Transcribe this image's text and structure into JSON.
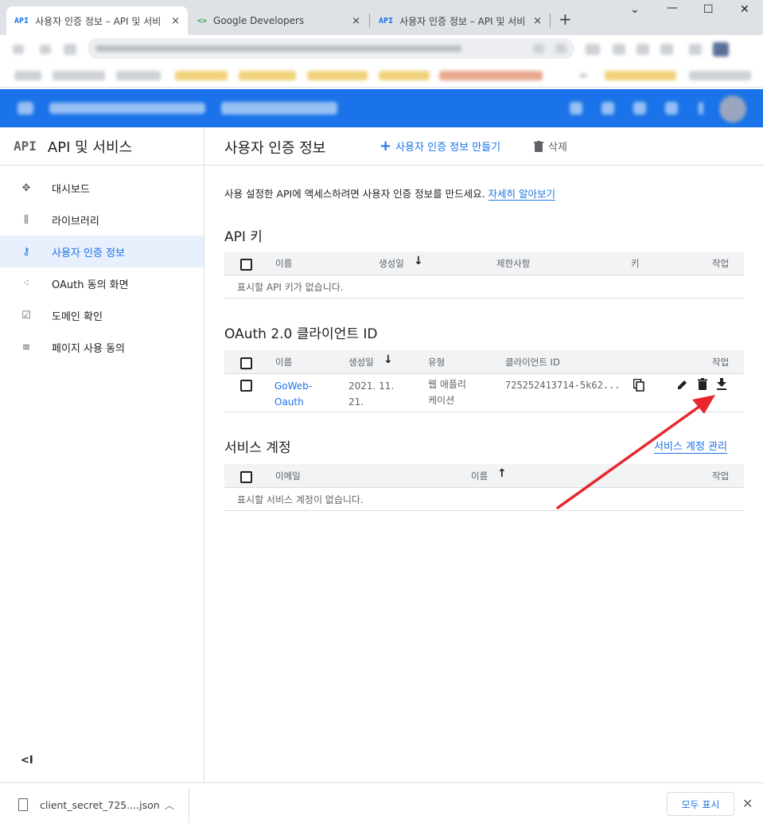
{
  "browser": {
    "tabs": [
      {
        "favicon": "API",
        "title": "사용자 인증 정보 – API 및 서비",
        "close": "×"
      },
      {
        "favicon": "<>",
        "title": "Google Developers",
        "close": "×"
      },
      {
        "favicon": "API",
        "title": "사용자 인증 정보 – API 및 서비",
        "close": "×"
      }
    ],
    "new_tab": "+",
    "window_controls": {
      "minimize": "⌄",
      "restore": "—",
      "maximize": "☐",
      "close": "✕"
    }
  },
  "sidebar": {
    "logo": "API",
    "title": "API 및 서비스",
    "items": [
      {
        "label": "대시보드",
        "icon": "dashboard-icon",
        "glyph": "✥"
      },
      {
        "label": "라이브러리",
        "icon": "library-icon",
        "glyph": "⫼"
      },
      {
        "label": "사용자 인증 정보",
        "icon": "key-icon",
        "glyph": "⚷"
      },
      {
        "label": "OAuth 동의 화면",
        "icon": "consent-icon",
        "glyph": "⁖"
      },
      {
        "label": "도메인 확인",
        "icon": "checkbox-icon",
        "glyph": "☑"
      },
      {
        "label": "페이지 사용 동의",
        "icon": "settings-list-icon",
        "glyph": "≡"
      }
    ],
    "active_index": 2,
    "collapse": "<I"
  },
  "main": {
    "title": "사용자 인증 정보",
    "create_label": "사용자 인증 정보 만들기",
    "delete_label": "삭제",
    "intro_text": "사용 설정한 API에 액세스하려면 사용자 인증 정보를 만드세요. ",
    "intro_link": "자세히 알아보기"
  },
  "api_keys": {
    "title": "API 키",
    "columns": {
      "name": "이름",
      "created": "생성일",
      "restrictions": "제한사항",
      "key": "키",
      "actions": "작업"
    },
    "empty": "표시할 API 키가 없습니다."
  },
  "oauth": {
    "title": "OAuth 2.0 클라이언트 ID",
    "columns": {
      "name": "이름",
      "created": "생성일",
      "type": "유형",
      "client_id": "클라이언트 ID",
      "actions": "작업"
    },
    "rows": [
      {
        "name_l1": "GoWeb-",
        "name_l2": "Oauth",
        "date_l1": "2021. 11.",
        "date_l2": "21.",
        "type_l1": "웹 애플리",
        "type_l2": "케이션",
        "client_id": "725252413714-5k62..."
      }
    ]
  },
  "service_accounts": {
    "title": "서비스 계정",
    "manage_link": "서비스 계정 관리",
    "columns": {
      "email": "이메일",
      "name": "이름",
      "actions": "작업"
    },
    "empty": "표시할 서비스 계정이 없습니다."
  },
  "download_bar": {
    "file_name": "client_secret_725....json",
    "show_all": "모두 표시"
  },
  "colors": {
    "accent": "#1a73e8",
    "annotation_arrow": "#e8262d"
  }
}
